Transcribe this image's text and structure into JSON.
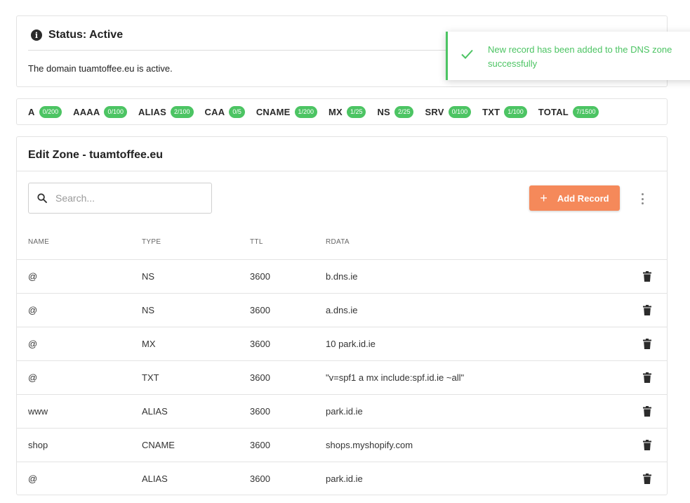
{
  "status": {
    "title": "Status: Active",
    "message": "The domain tuamtoffee.eu is active."
  },
  "record_counts": [
    {
      "type": "A",
      "count": "0/200"
    },
    {
      "type": "AAAA",
      "count": "0/100"
    },
    {
      "type": "ALIAS",
      "count": "2/100"
    },
    {
      "type": "CAA",
      "count": "0/5"
    },
    {
      "type": "CNAME",
      "count": "1/200"
    },
    {
      "type": "MX",
      "count": "1/25"
    },
    {
      "type": "NS",
      "count": "2/25"
    },
    {
      "type": "SRV",
      "count": "0/100"
    },
    {
      "type": "TXT",
      "count": "1/100"
    },
    {
      "type": "TOTAL",
      "count": "7/1500"
    }
  ],
  "zone": {
    "title": "Edit Zone - tuamtoffee.eu",
    "search_placeholder": "Search...",
    "add_record_label": "Add Record",
    "columns": {
      "name": "NAME",
      "type": "TYPE",
      "ttl": "TTL",
      "rdata": "RDATA"
    },
    "records": [
      {
        "name": "@",
        "type": "NS",
        "ttl": "3600",
        "rdata": "b.dns.ie"
      },
      {
        "name": "@",
        "type": "NS",
        "ttl": "3600",
        "rdata": "a.dns.ie"
      },
      {
        "name": "@",
        "type": "MX",
        "ttl": "3600",
        "rdata": "10 park.id.ie"
      },
      {
        "name": "@",
        "type": "TXT",
        "ttl": "3600",
        "rdata": "\"v=spf1 a mx include:spf.id.ie ~all\""
      },
      {
        "name": "www",
        "type": "ALIAS",
        "ttl": "3600",
        "rdata": "park.id.ie"
      },
      {
        "name": "shop",
        "type": "CNAME",
        "ttl": "3600",
        "rdata": "shops.myshopify.com"
      },
      {
        "name": "@",
        "type": "ALIAS",
        "ttl": "3600",
        "rdata": "park.id.ie"
      }
    ]
  },
  "toast": {
    "message": "New record has been added to the DNS zone successfully"
  },
  "colors": {
    "success": "#4cc463",
    "accent": "#f5895a"
  }
}
